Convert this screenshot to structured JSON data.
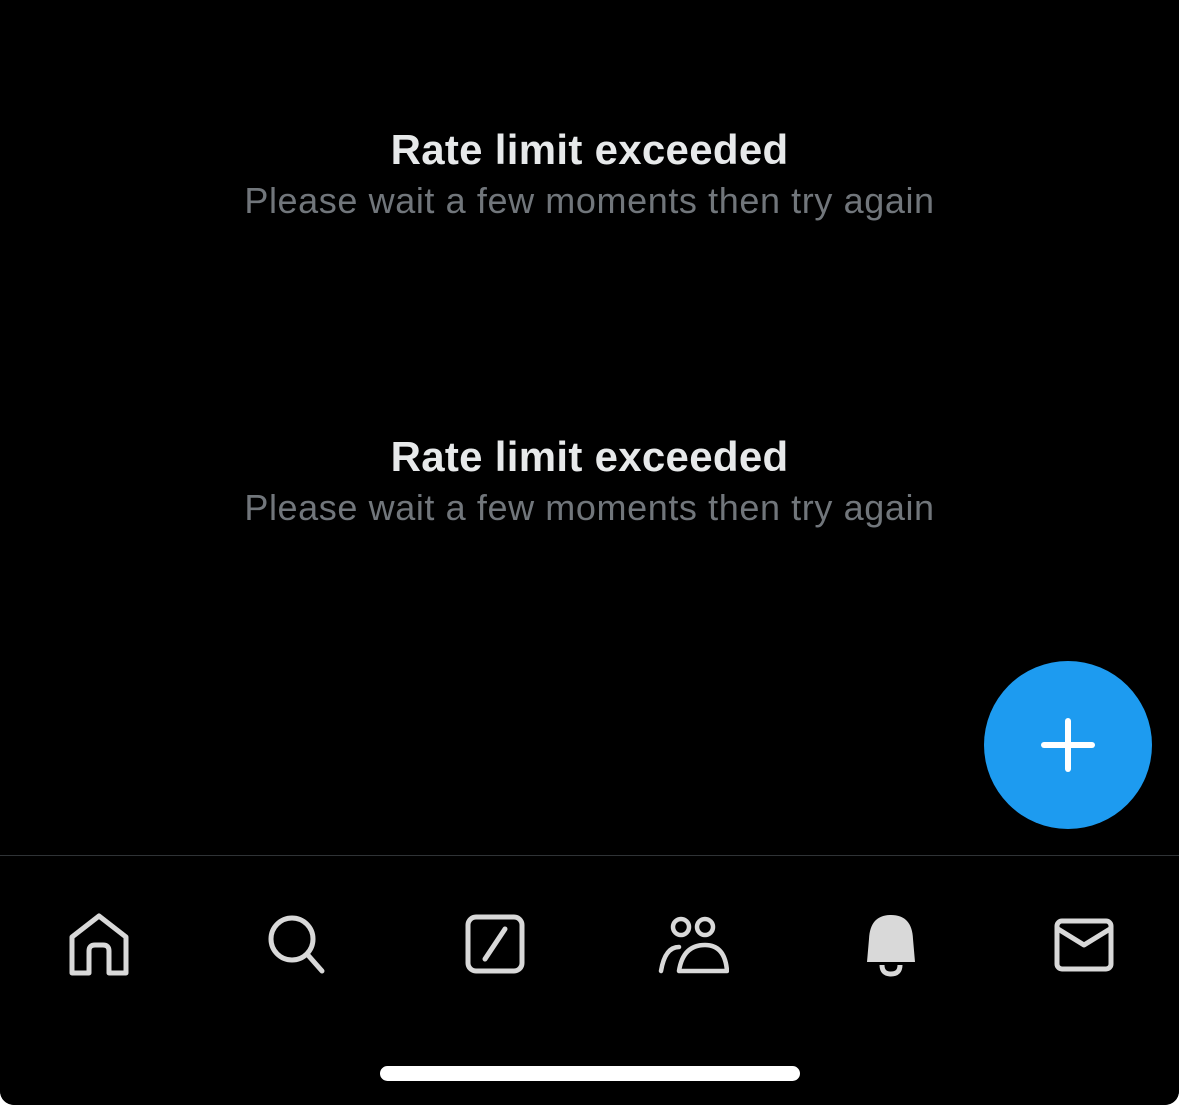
{
  "messages": [
    {
      "title": "Rate limit exceeded",
      "subtitle": "Please wait a few moments then try again"
    },
    {
      "title": "Rate limit exceeded",
      "subtitle": "Please wait a few moments then try again"
    }
  ],
  "compose_fab": {
    "icon": "plus-icon",
    "color": "#1d9bf0"
  },
  "tab_bar": {
    "tabs": [
      {
        "icon": "home-icon"
      },
      {
        "icon": "search-icon"
      },
      {
        "icon": "grok-icon"
      },
      {
        "icon": "communities-icon"
      },
      {
        "icon": "bell-icon",
        "active": true
      },
      {
        "icon": "mail-icon"
      }
    ],
    "icon_color": "#d9d9d9"
  },
  "colors": {
    "background": "#000000",
    "title_text": "#e7e9ea",
    "subtitle_text": "#71767b",
    "accent": "#1d9bf0",
    "divider": "#2f3336"
  }
}
